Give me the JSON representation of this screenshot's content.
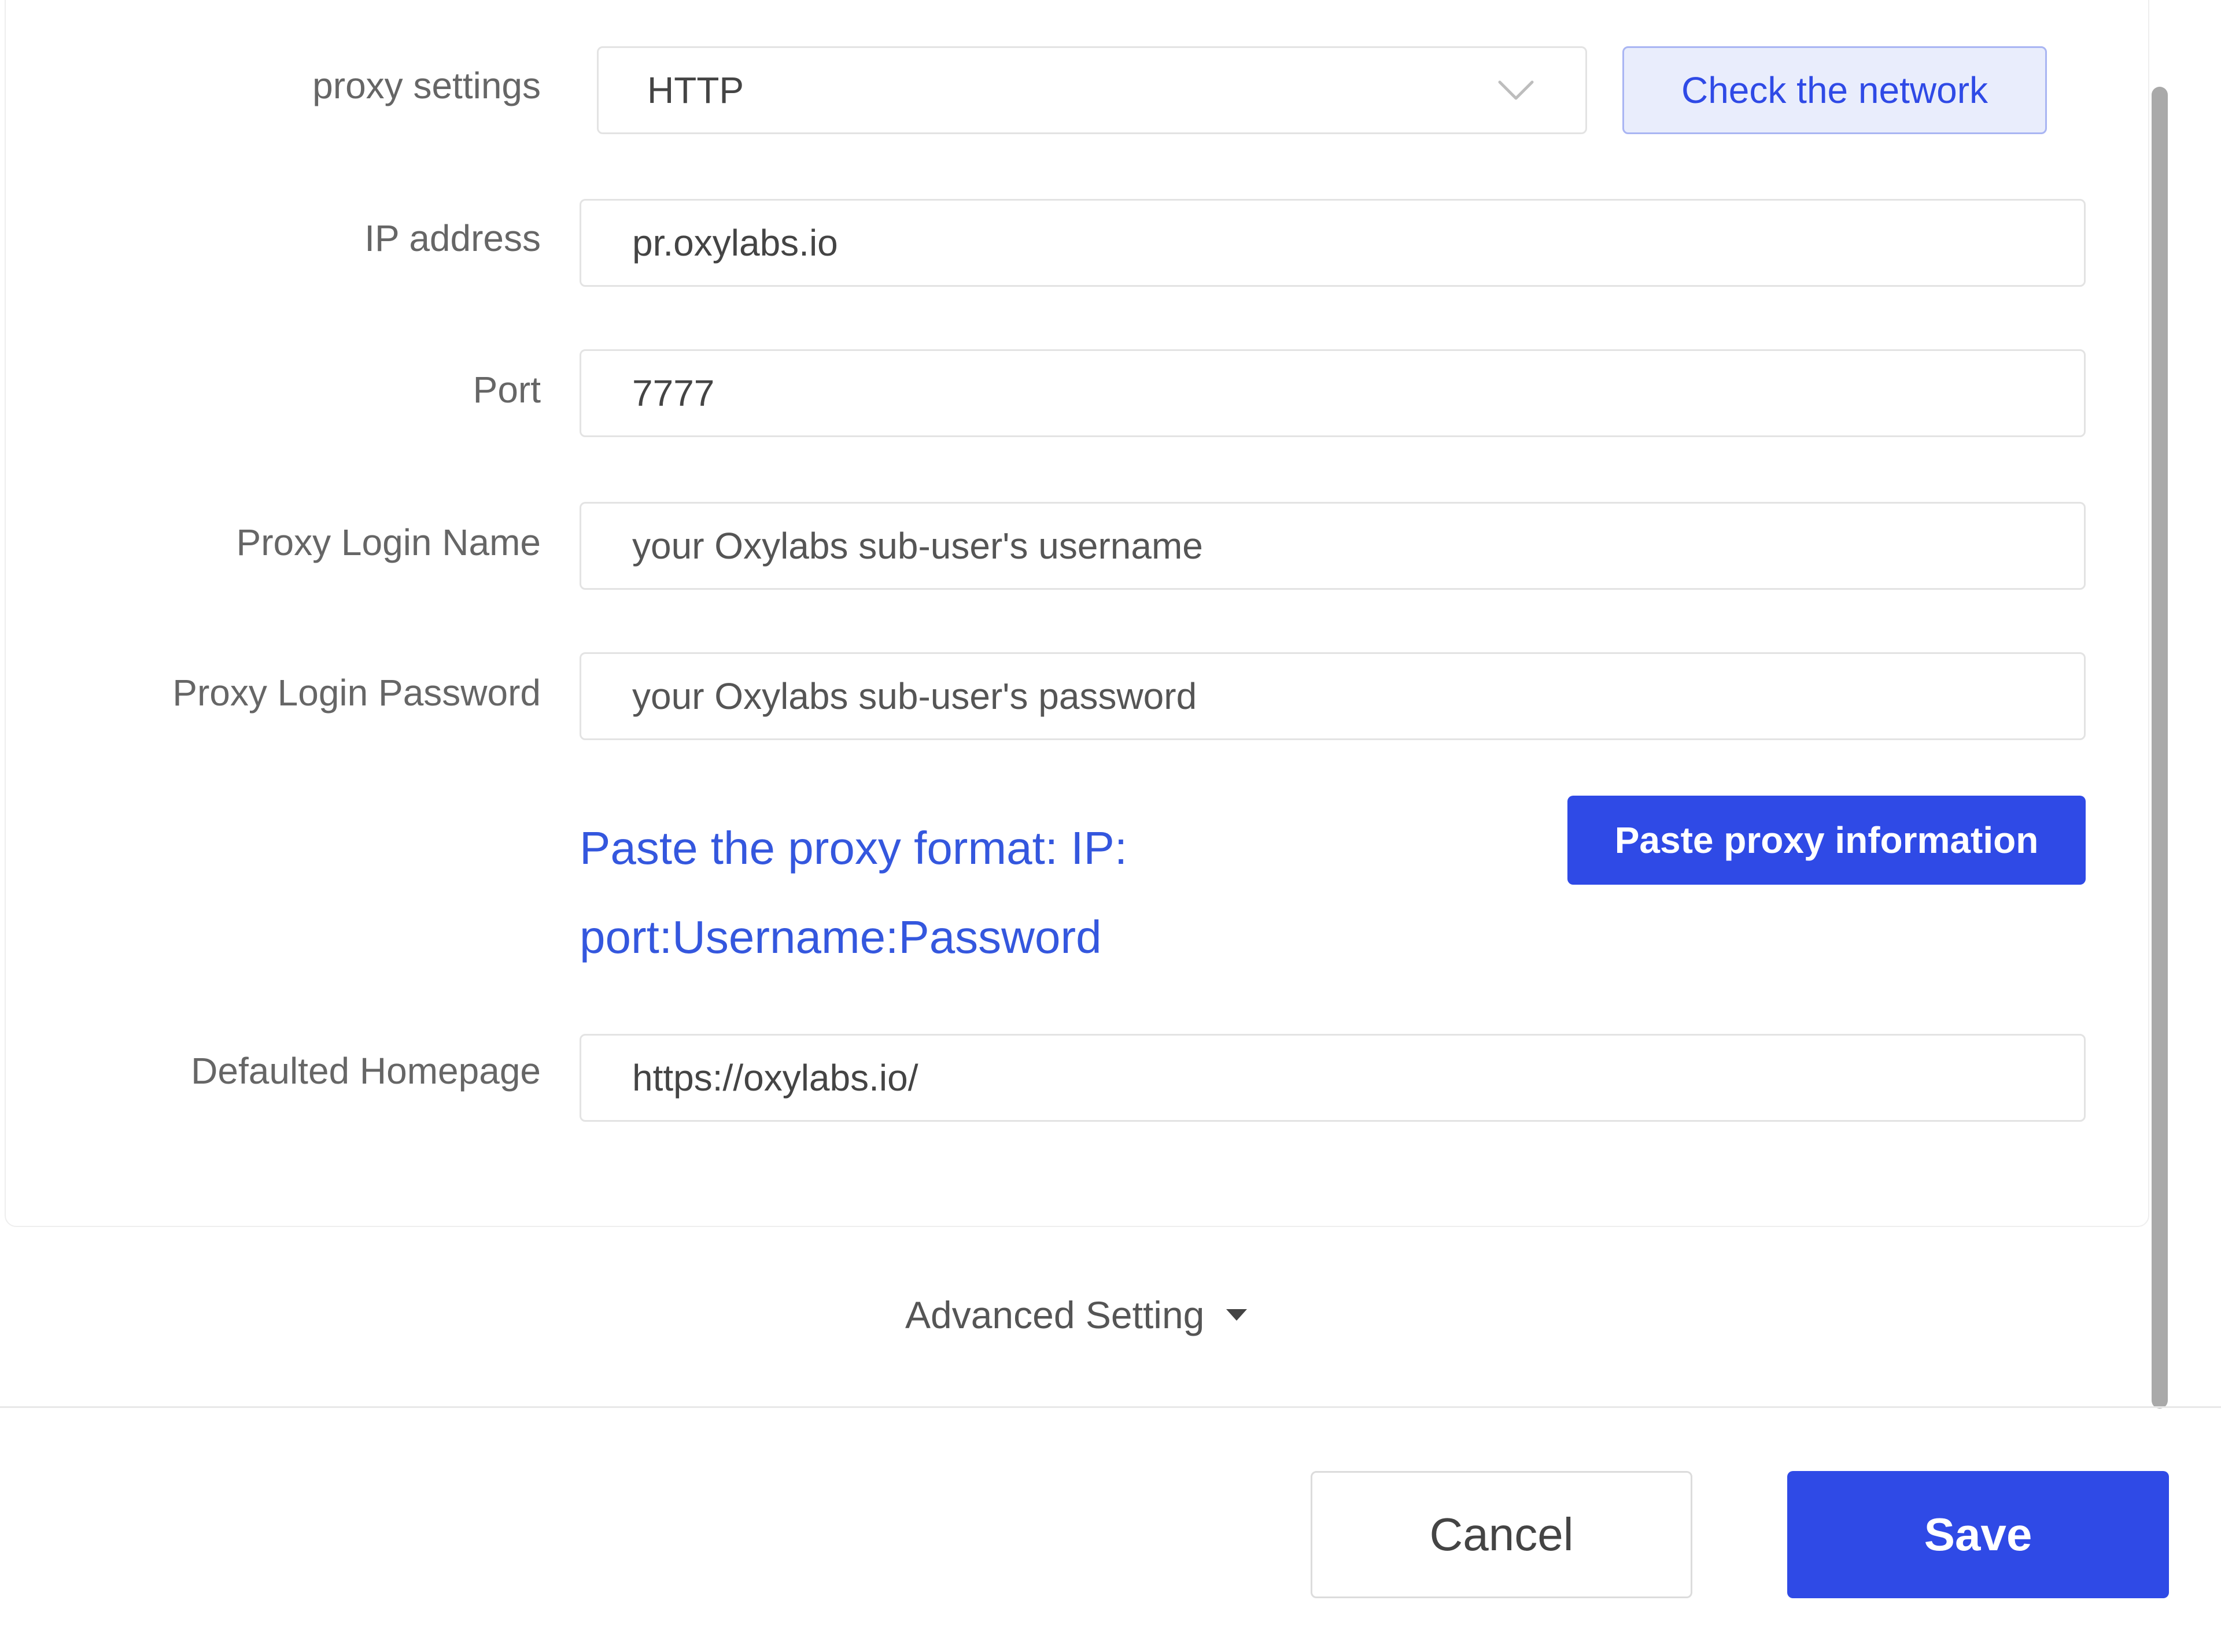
{
  "form": {
    "proxy_settings": {
      "label": "proxy settings",
      "selected": "HTTP"
    },
    "check_network_label": "Check the network",
    "ip_address": {
      "label": "IP address",
      "value": "pr.oxylabs.io"
    },
    "port": {
      "label": "Port",
      "value": "7777"
    },
    "login_name": {
      "label": "Proxy Login Name",
      "placeholder": "your Oxylabs sub-user's username"
    },
    "login_password": {
      "label": "Proxy Login Password",
      "placeholder": "your Oxylabs sub-user's password"
    },
    "paste_format_text": "Paste the proxy format: IP: port:Username:Password",
    "paste_button_label": "Paste proxy information",
    "homepage": {
      "label": "Defaulted Homepage",
      "value": "https://oxylabs.io/"
    }
  },
  "advanced_setting_label": "Advanced Setting",
  "footer": {
    "cancel_label": "Cancel",
    "save_label": "Save"
  },
  "icons": {
    "dropdown": "chevron-down-icon",
    "advanced": "caret-down-icon"
  },
  "colors": {
    "primary": "#2f4ae6",
    "link": "#3457de",
    "secondary_button_bg": "#e9edfc"
  }
}
